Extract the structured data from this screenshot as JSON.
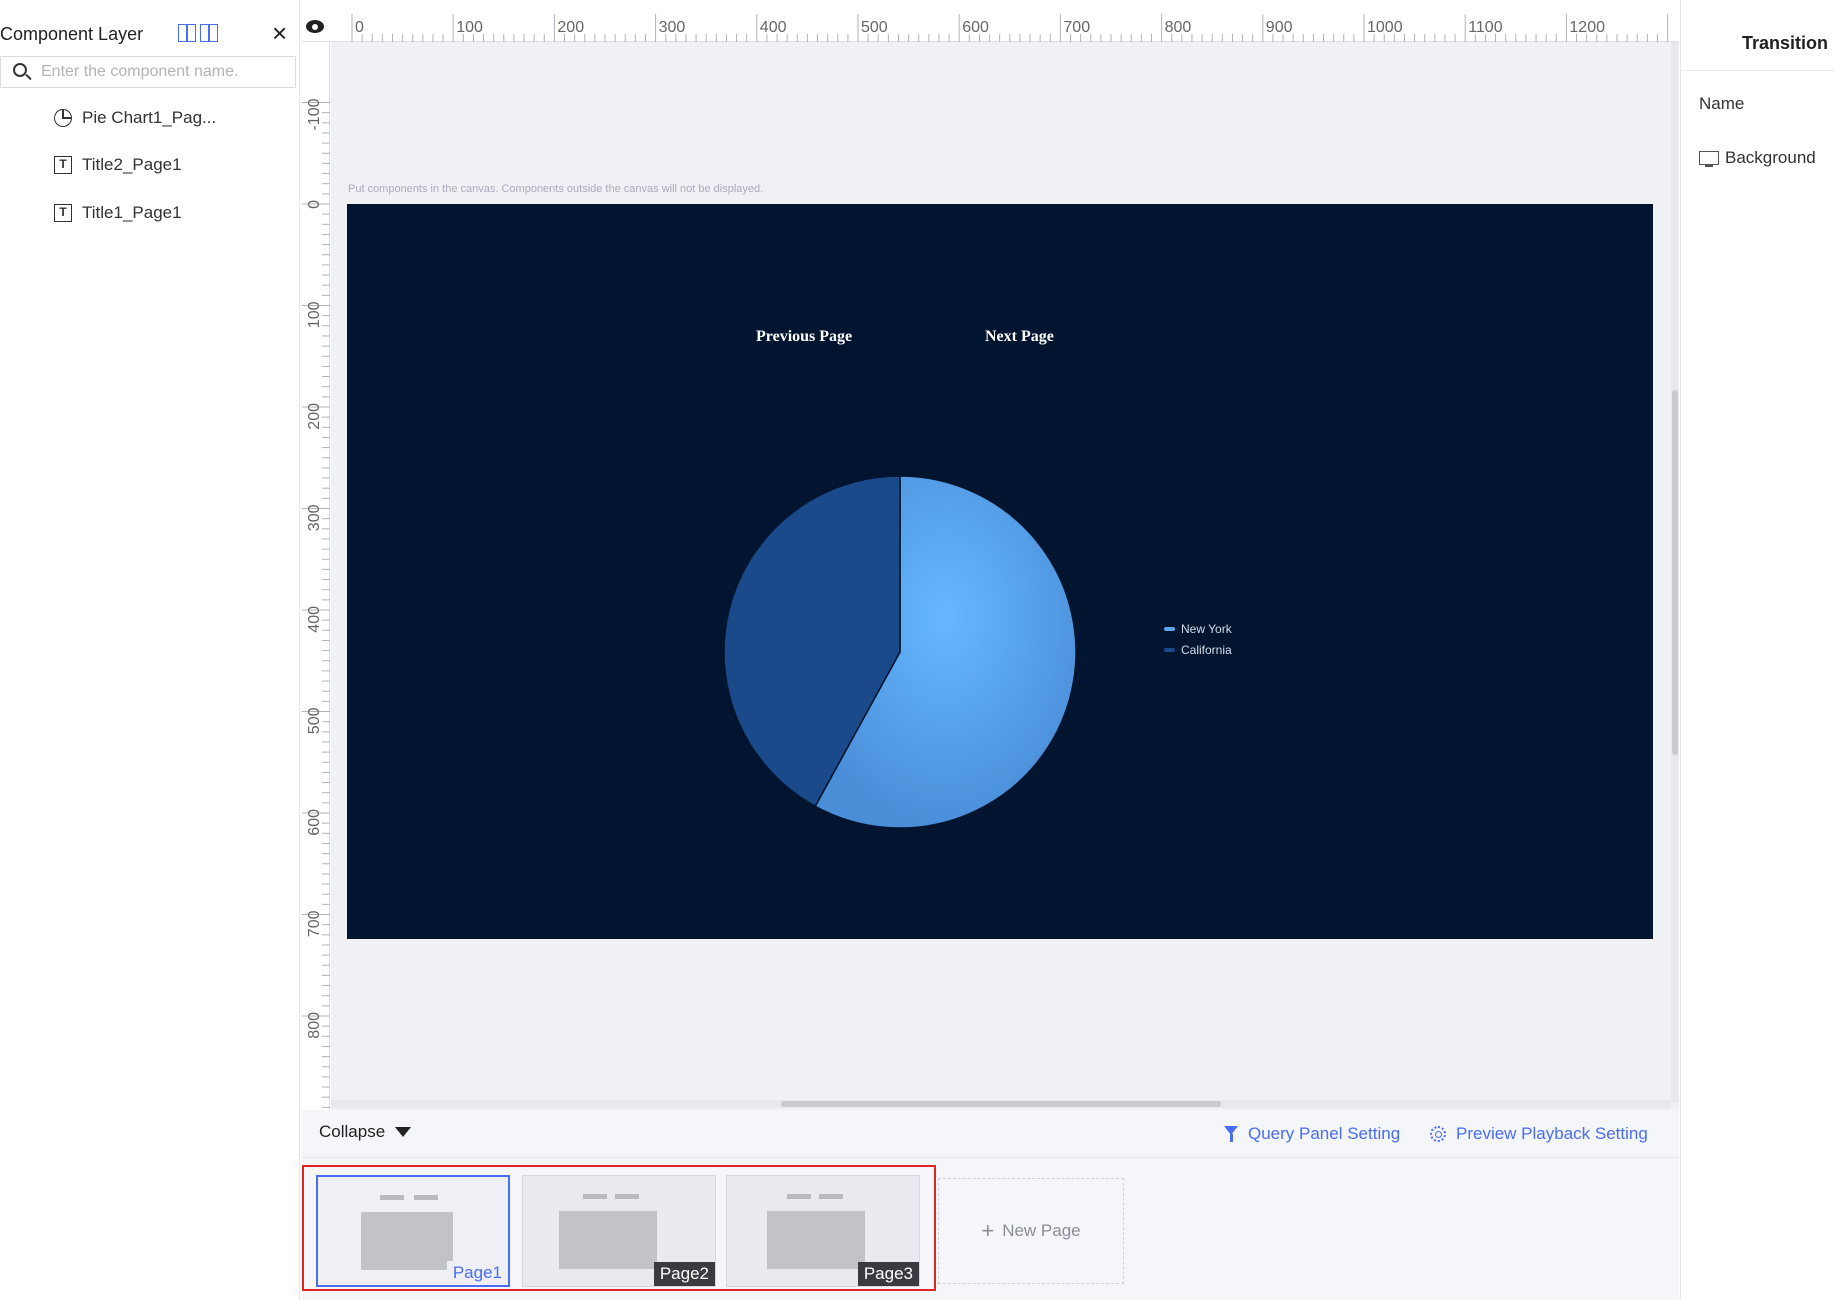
{
  "left_panel": {
    "title": "Component Layer",
    "search_placeholder": "Enter the component name.",
    "layers": [
      {
        "label": "Pie Chart1_Pag...",
        "icon": "pie-chart-icon"
      },
      {
        "label": "Title2_Page1",
        "icon": "text-icon"
      },
      {
        "label": "Title1_Page1",
        "icon": "text-icon"
      }
    ]
  },
  "rulers": {
    "top_ticks": [
      "0",
      "100",
      "200",
      "300",
      "400",
      "500",
      "600",
      "700",
      "800",
      "900",
      "1000",
      "1100",
      "1200"
    ],
    "left_ticks": [
      "-100",
      "0",
      "100",
      "200",
      "300",
      "400",
      "500",
      "600",
      "700",
      "800"
    ]
  },
  "canvas": {
    "note": "Put components in the canvas. Components outside the canvas will not be displayed.",
    "background": "#011530",
    "prev_label": "Previous Page",
    "next_label": "Next Page"
  },
  "chart_data": {
    "type": "pie",
    "categories": [
      "New York",
      "California"
    ],
    "values": [
      58,
      42
    ],
    "colors": [
      "#5aa6ee",
      "#1a4a8a"
    ],
    "legend_position": "right"
  },
  "bottom_bar": {
    "collapse_label": "Collapse",
    "query_panel_label": "Query Panel Setting",
    "preview_playback_label": "Preview Playback Setting",
    "pages": [
      {
        "label": "Page1",
        "active": true
      },
      {
        "label": "Page2",
        "active": false
      },
      {
        "label": "Page3",
        "active": false
      }
    ],
    "new_page_label": "New Page"
  },
  "right_panel": {
    "tab_label": "Transition",
    "name_label": "Name",
    "background_label": "Background"
  },
  "colors": {
    "accent": "#4a6cf7",
    "highlight_frame": "#e02424"
  }
}
